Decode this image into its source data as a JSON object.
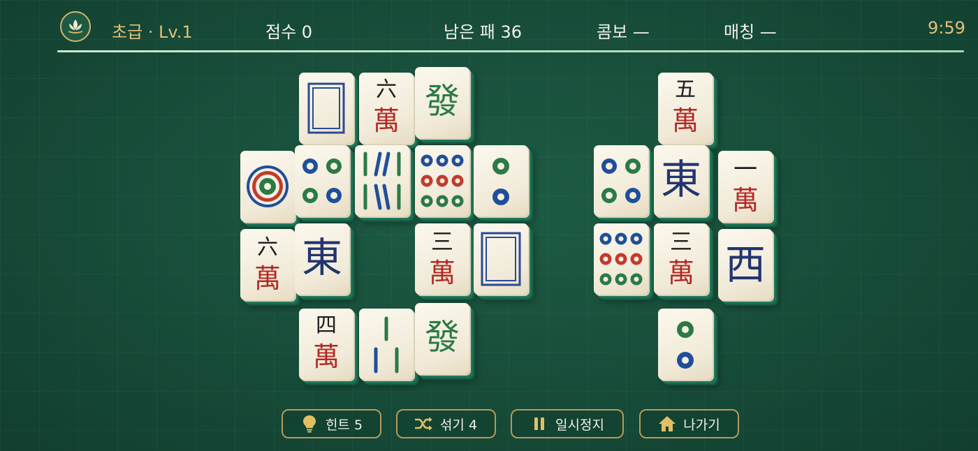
{
  "hud": {
    "level": "초급 · Lv.1",
    "score": "점수 0",
    "remaining": "남은 패 36",
    "combo": "콤보 —",
    "matches": "매칭 —",
    "timer": "9:59"
  },
  "tile_faces": {
    "six_wan": [
      "六",
      "萬"
    ],
    "five_wan": [
      "五",
      "萬"
    ],
    "one_wan": [
      "一",
      "萬"
    ],
    "three_wan": [
      "三",
      "萬"
    ],
    "four_wan": [
      "四",
      "萬"
    ],
    "green_dragon": "發",
    "east_wind": "東",
    "west_wind": "西"
  },
  "buttons": {
    "hint": "힌트 5",
    "shuffle": "섞기 4",
    "pause": "일시정지",
    "exit": "나가기"
  },
  "colors": {
    "gold": "#e0c07a",
    "felt": "#174c39",
    "wan_red": "#b32a24",
    "wind_blue": "#23356f",
    "dragon_green": "#2b7a47"
  }
}
